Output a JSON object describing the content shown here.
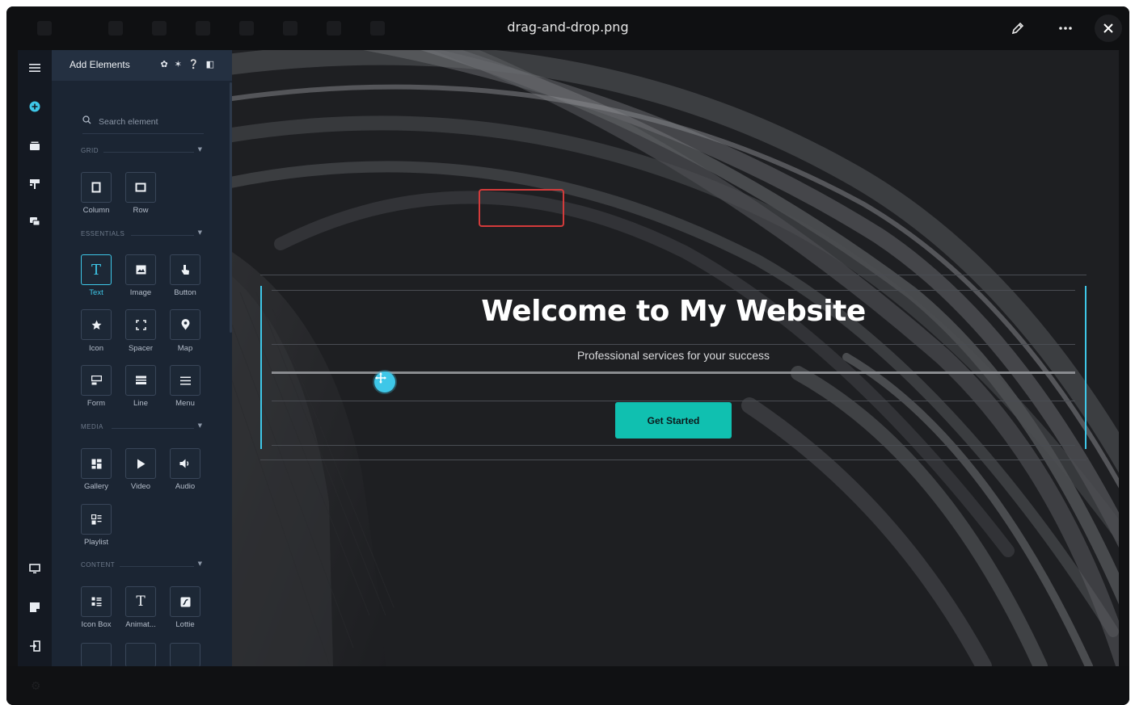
{
  "window": {
    "title": "drag-and-drop.png"
  },
  "toolbar": {
    "edit_icon": "pencil-icon",
    "more_icon": "ellipsis-icon",
    "close_icon": "close-icon"
  },
  "rail": {
    "icons": [
      "hamburger-icon",
      "add-circle-icon",
      "layers-icon",
      "paint-icon",
      "comments-icon",
      "desktop-icon",
      "notes-icon",
      "exit-icon"
    ]
  },
  "panel": {
    "title": "Add Elements",
    "search_placeholder": "Search element",
    "sections": {
      "grid": "GRID",
      "essentials": "ESSENTIALS",
      "media": "MEDIA",
      "content": "CONTENT"
    },
    "grid_items": [
      "Column",
      "Row"
    ],
    "essentials_items": [
      "Text",
      "Image",
      "Button",
      "Icon",
      "Spacer",
      "Map",
      "Form",
      "Line",
      "Menu"
    ],
    "media_items": [
      "Gallery",
      "Video",
      "Audio",
      "Playlist"
    ],
    "content_items": [
      "Icon Box",
      "Animat...",
      "Lottie"
    ]
  },
  "canvas": {
    "headline": "Welcome to My Website",
    "subline": "Professional  services for your success",
    "cta_label": "Get Started",
    "accent_color": "#3ec7e8",
    "cta_color": "#10c0b0"
  }
}
